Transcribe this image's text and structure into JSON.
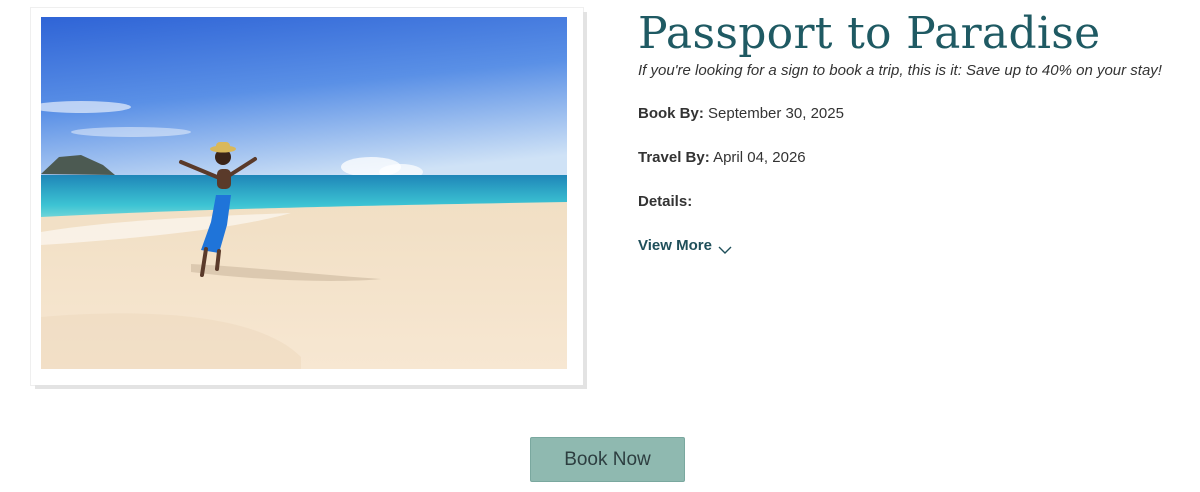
{
  "offer": {
    "title": "Passport to Paradise",
    "subtitle": "If you're looking for a sign to book a trip, this is it: Save up to 40% on your stay!",
    "book_by_label": "Book By:",
    "book_by_value": "September 30, 2025",
    "travel_by_label": "Travel By:",
    "travel_by_value": "April 04, 2026",
    "details_label": "Details:",
    "view_more_label": "View More",
    "view_more_icon": "chevron-down-icon"
  },
  "cta": {
    "book_now_label": "Book Now"
  },
  "colors": {
    "title": "#1f5a63",
    "button_bg": "#8fb9b0",
    "link": "#1f4f5a"
  }
}
